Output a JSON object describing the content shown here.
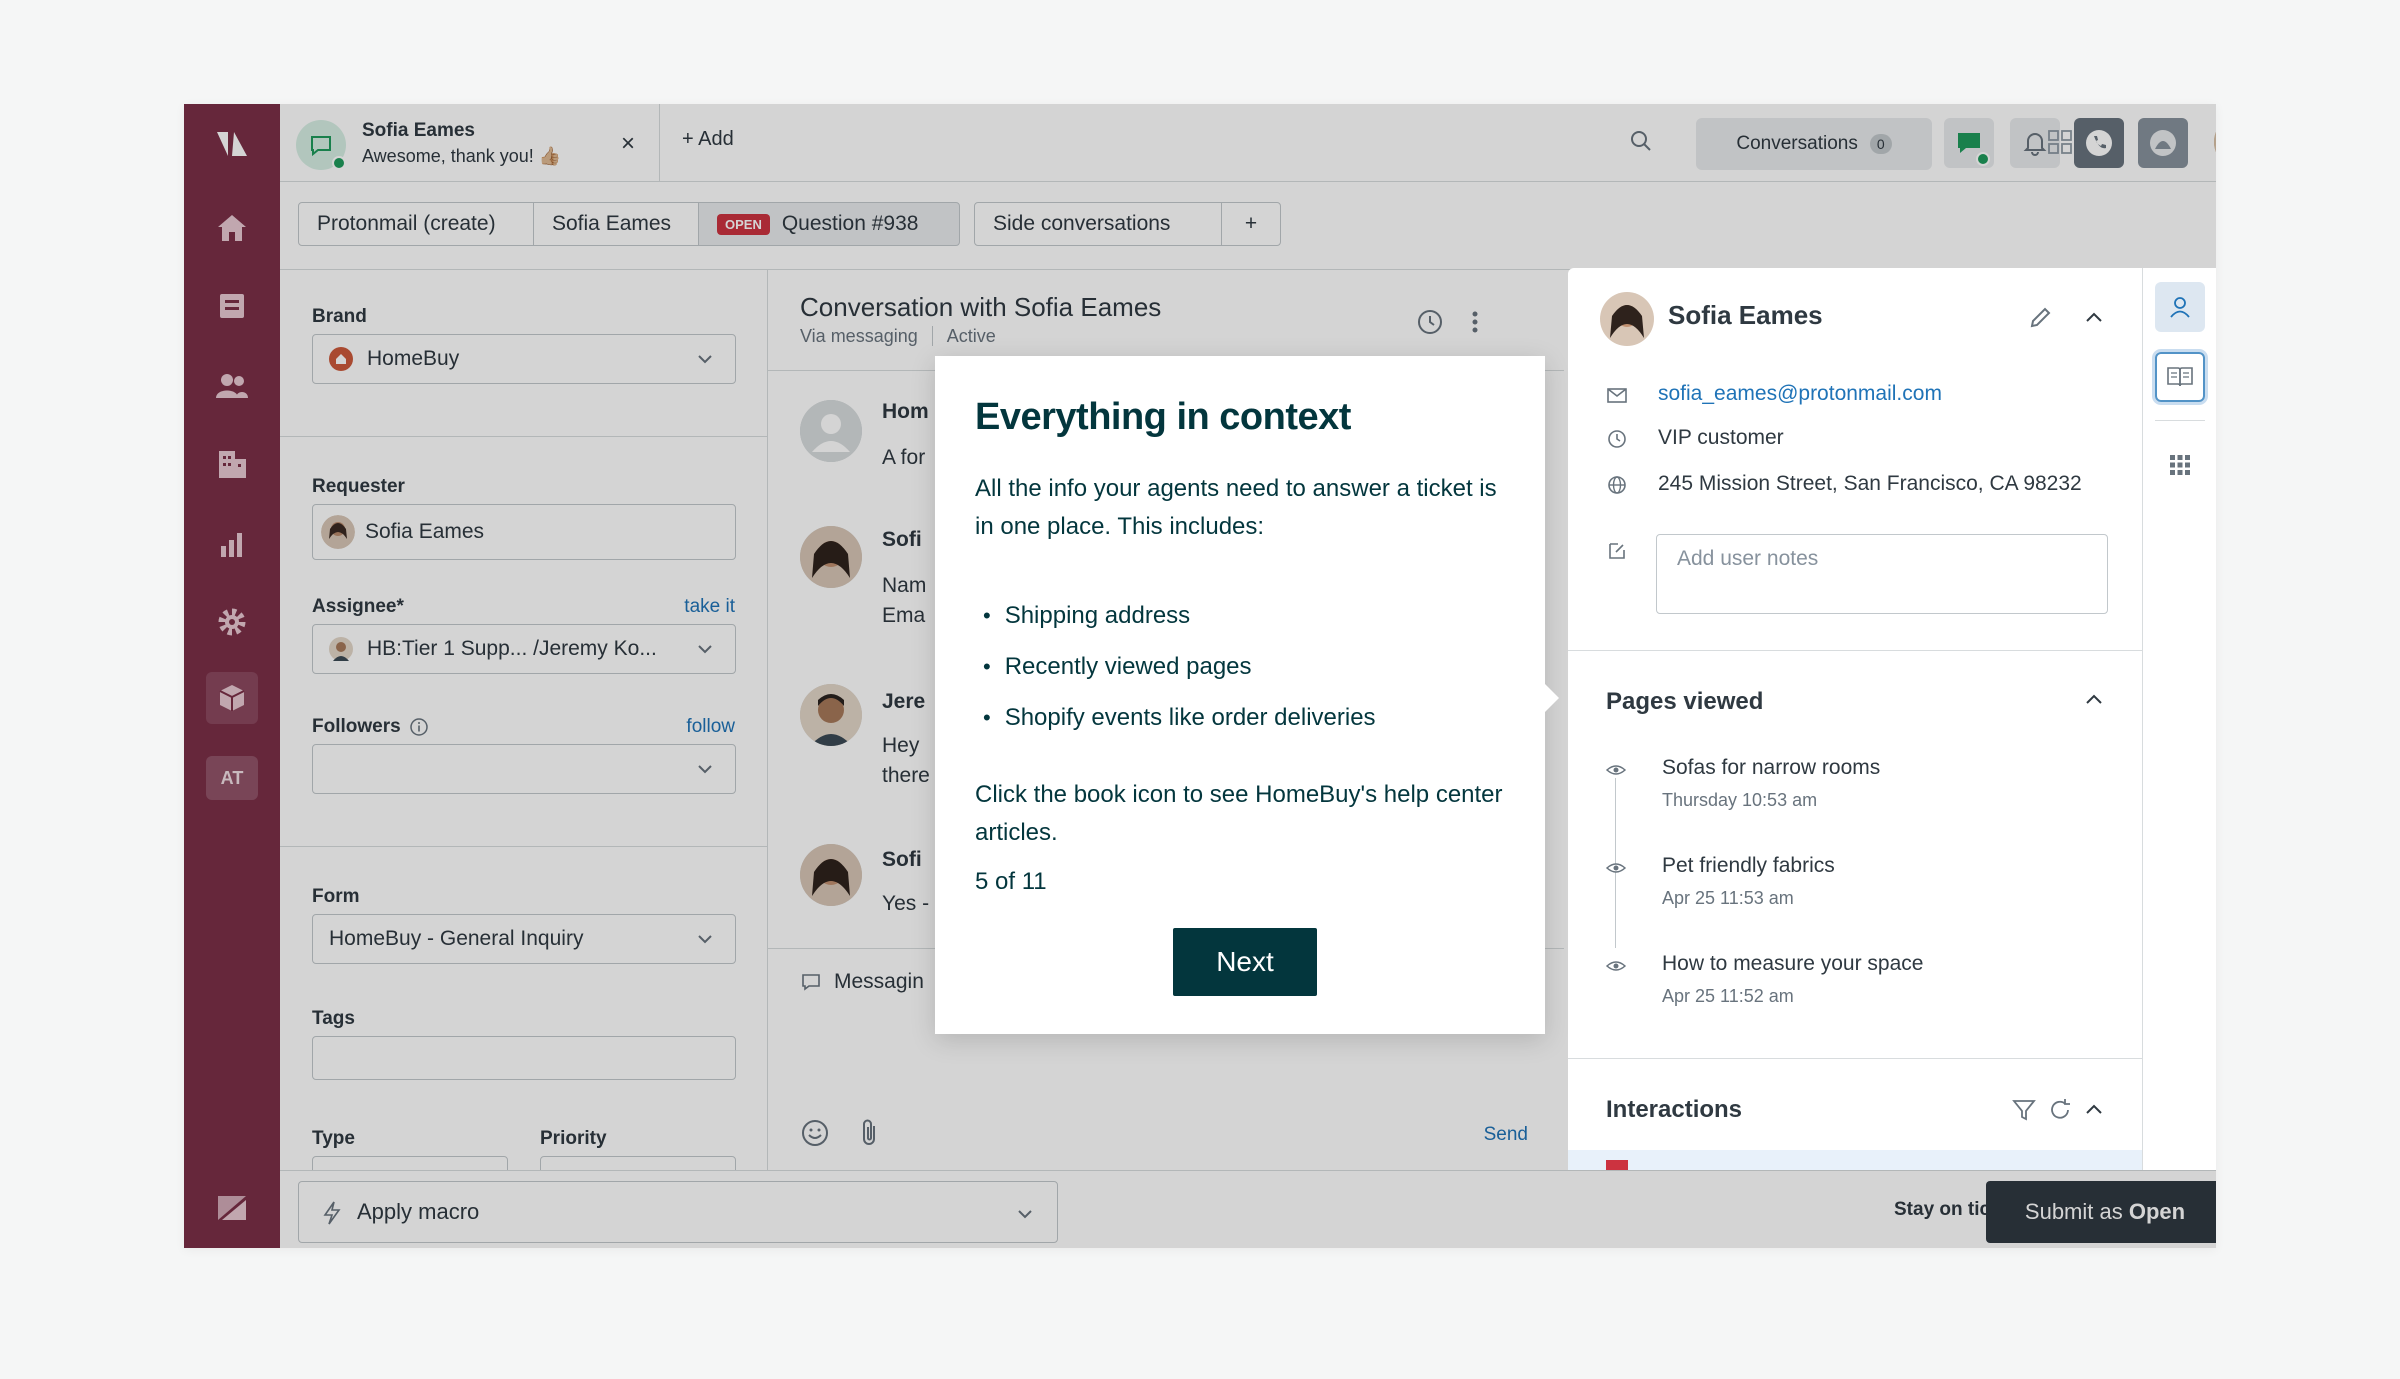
{
  "colors": {
    "nav_bg": "#7b2f48",
    "link": "#1f73b7",
    "open_badge": "#cc3340",
    "popover_accent": "#03363d",
    "submit": "#2f3941"
  },
  "nav": {
    "items": [
      "logo-icon",
      "home-icon",
      "views-icon",
      "customers-icon",
      "organizations-icon",
      "reporting-icon",
      "admin-icon",
      "apps-icon"
    ],
    "at_label": "AT"
  },
  "topbar": {
    "ticket_tab": {
      "name": "Sofia Eames",
      "message": "Awesome, thank you! 👍🏼"
    },
    "add_label": "Add",
    "conversations_label": "Conversations",
    "conversations_count": "0"
  },
  "tabs": {
    "protonmail": "Protonmail (create)",
    "requester": "Sofia Eames",
    "open_badge": "OPEN",
    "question": "Question #938",
    "side": "Side conversations",
    "plus": "+"
  },
  "form": {
    "brand_label": "Brand",
    "brand_value": "HomeBuy",
    "requester_label": "Requester",
    "requester_value": "Sofia Eames",
    "assignee_label": "Assignee*",
    "take_it": "take it",
    "assignee_value": "HB:Tier 1 Supp... /Jeremy Ko...",
    "followers_label": "Followers",
    "follow": "follow",
    "form_label": "Form",
    "form_value": "HomeBuy - General Inquiry",
    "tags_label": "Tags",
    "type_label": "Type",
    "priority_label": "Priority"
  },
  "conversation": {
    "title": "Conversation with Sofia Eames",
    "channel": "Via messaging",
    "status": "Active",
    "messages": [
      {
        "name": "Hom",
        "text": "A for"
      },
      {
        "name": "Sofi",
        "text": "Nam",
        "text2": "Ema"
      },
      {
        "name": "Jere",
        "text": "Hey",
        "text2": "there"
      },
      {
        "name": "Sofi",
        "text": "Yes -"
      }
    ],
    "composer": "Messagin",
    "send": "Send"
  },
  "context": {
    "user": "Sofia Eames",
    "email": "sofia_eames@protonmail.com",
    "tier": "VIP customer",
    "address": "245 Mission Street, San Francisco, CA 98232",
    "notes_placeholder": "Add user notes",
    "pages_title": "Pages viewed",
    "pages": [
      {
        "title": "Sofas for narrow rooms",
        "date": "Thursday 10:53 am"
      },
      {
        "title": "Pet friendly fabrics",
        "date": "Apr 25 11:53 am"
      },
      {
        "title": "How to measure your space",
        "date": "Apr 25 11:52 am"
      }
    ],
    "interactions_title": "Interactions"
  },
  "footer": {
    "macro": "Apply macro",
    "stay": "Stay on ticket",
    "submit_prefix": "Submit as ",
    "submit_status": "Open"
  },
  "popover": {
    "title": "Everything in context",
    "intro": "All the info your agents need to answer a ticket is in one place. This includes:",
    "bullets": [
      "Shipping address",
      "Recently viewed pages",
      "Shopify events like order deliveries"
    ],
    "outro": "Click the book icon to see HomeBuy's help center articles.",
    "step": "5 of 11",
    "next": "Next"
  }
}
